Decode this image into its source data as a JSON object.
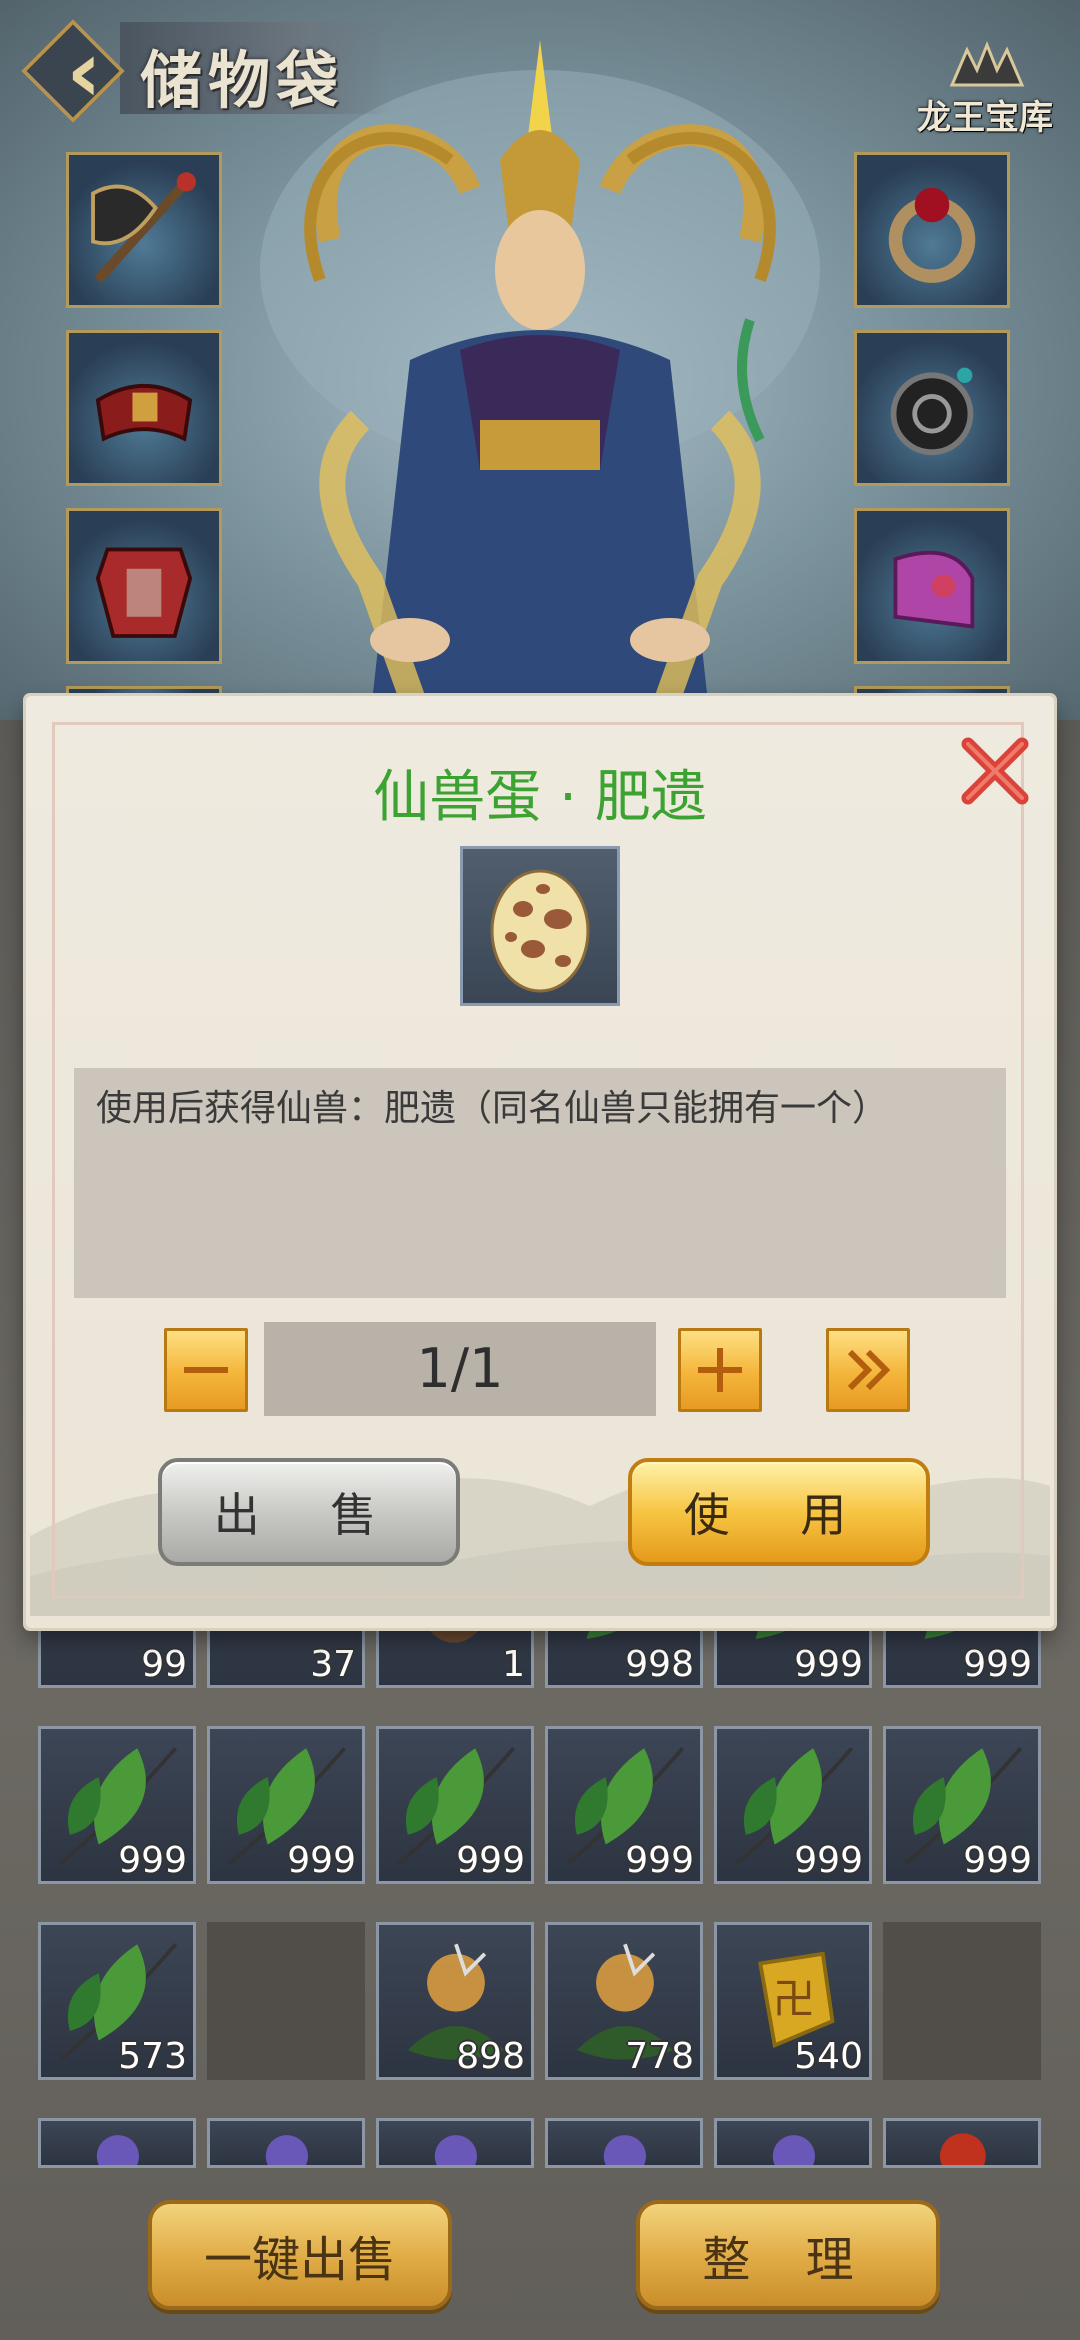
{
  "header": {
    "title": "储物袋",
    "treasure_label": "龙王宝库"
  },
  "dialog": {
    "title": "仙兽蛋 · 肥遗",
    "item_icon": "spotted-egg",
    "description": "使用后获得仙兽：肥遗（同名仙兽只能拥有一个）",
    "quantity": "1/1",
    "sell_label": "出 售",
    "use_label": "使 用"
  },
  "inventory": {
    "row1_counts": [
      "99",
      "37",
      "1",
      "998",
      "999",
      "999"
    ],
    "row2_counts": [
      "999",
      "999",
      "999",
      "999",
      "999",
      "999"
    ],
    "row3_counts": [
      "573",
      "",
      "898",
      "778",
      "540",
      ""
    ]
  },
  "footer": {
    "sell_all_label": "一键出售",
    "sort_label": "整 理"
  },
  "colors": {
    "title_green": "#3ca232",
    "gold": "#f4b53a",
    "close_red": "#d9433a"
  }
}
